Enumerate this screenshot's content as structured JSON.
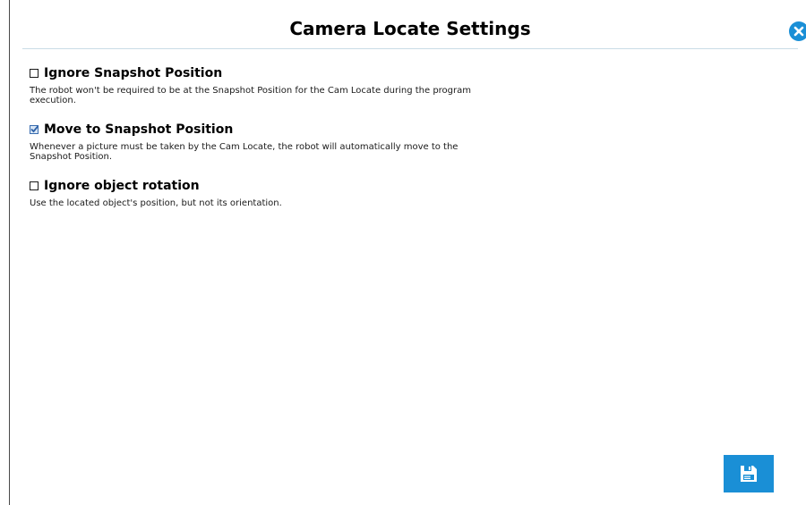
{
  "dialog": {
    "title": "Camera Locate Settings",
    "close_icon": "close-icon",
    "save_icon": "save-icon",
    "accent_color": "#1a8fd6"
  },
  "options": [
    {
      "label": "Ignore Snapshot Position",
      "checked": false,
      "description": "The robot won't be required to be at the Snapshot Position for the Cam Locate during the program execution."
    },
    {
      "label": "Move to Snapshot Position",
      "checked": true,
      "description": "Whenever a picture must be taken by the Cam Locate, the robot will automatically move to the Snapshot Position."
    },
    {
      "label": "Ignore object rotation",
      "checked": false,
      "description": "Use the located object's position, but not its orientation."
    }
  ]
}
